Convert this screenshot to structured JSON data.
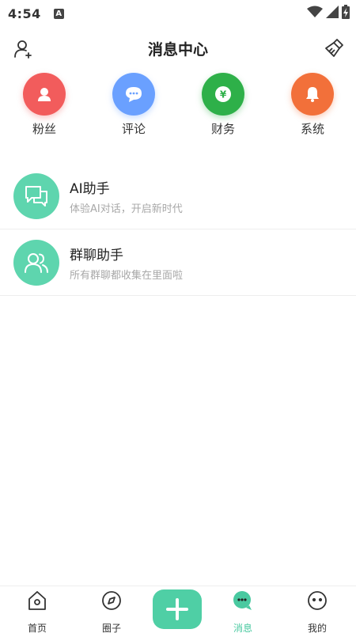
{
  "status_bar": {
    "time": "4:54",
    "notification_badge": "A"
  },
  "header": {
    "title": "消息中心"
  },
  "quick_entries": [
    {
      "label": "粉丝",
      "icon": "person-icon",
      "color": "#f25c5c"
    },
    {
      "label": "评论",
      "icon": "chat-bubble-icon",
      "color": "#6aa0ff"
    },
    {
      "label": "财务",
      "icon": "yuan-coin-icon",
      "color": "#2eb049"
    },
    {
      "label": "系统",
      "icon": "bell-icon",
      "color": "#f2703a"
    }
  ],
  "messages": [
    {
      "title": "AI助手",
      "subtitle": "体验AI对话，开启新时代",
      "icon": "chat-icon"
    },
    {
      "title": "群聊助手",
      "subtitle": "所有群聊都收集在里面啦",
      "icon": "group-icon"
    }
  ],
  "bottom_nav": {
    "items": [
      {
        "label": "首页",
        "icon": "home-icon"
      },
      {
        "label": "圈子",
        "icon": "compass-icon"
      },
      {
        "label": "消息",
        "icon": "message-icon",
        "active": true
      },
      {
        "label": "我的",
        "icon": "profile-face-icon"
      }
    ],
    "accent_color": "#4fcfa5"
  }
}
